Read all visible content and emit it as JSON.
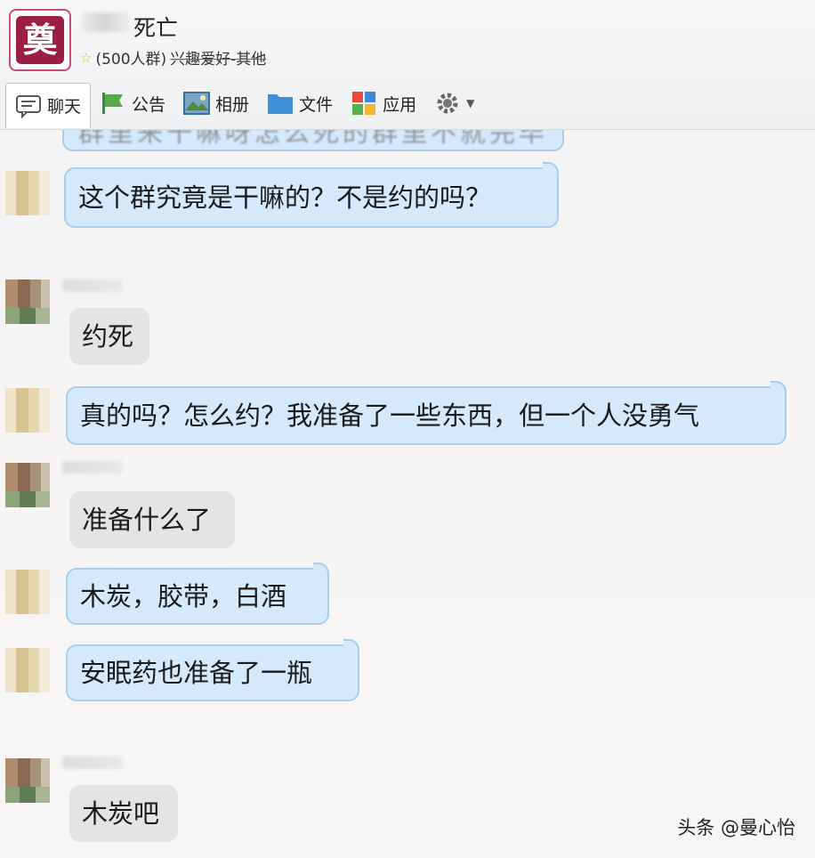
{
  "header": {
    "group_name": "死亡",
    "member_count": "(500人群)",
    "category": "兴趣爱好-其他"
  },
  "toolbar": [
    {
      "label": "聊天",
      "icon": "chat-icon"
    },
    {
      "label": "公告",
      "icon": "megaphone-icon"
    },
    {
      "label": "相册",
      "icon": "photo-album-icon"
    },
    {
      "label": "文件",
      "icon": "folder-icon"
    },
    {
      "label": "应用",
      "icon": "apps-icon"
    },
    {
      "label": "",
      "icon": "gear-icon"
    }
  ],
  "messages": [
    {
      "text": "这个群究竟是干嘛的？不是约的吗？",
      "style": "blue"
    },
    {
      "text": "约死",
      "style": "grey"
    },
    {
      "text": "真的吗？怎么约？我准备了一些东西，但一个人没勇气",
      "style": "blue"
    },
    {
      "text": "准备什么了",
      "style": "grey"
    },
    {
      "text": "木炭，胶带，白酒",
      "style": "blue"
    },
    {
      "text": "安眠药也准备了一瓶",
      "style": "blue"
    },
    {
      "text": "木炭吧",
      "style": "grey"
    }
  ],
  "watermark": "头条 @曼心怡",
  "colors": {
    "bubble_blue": "#d4e9fb",
    "bubble_grey": "#e4e4e7",
    "avatar_accent": "#9b1f45"
  }
}
